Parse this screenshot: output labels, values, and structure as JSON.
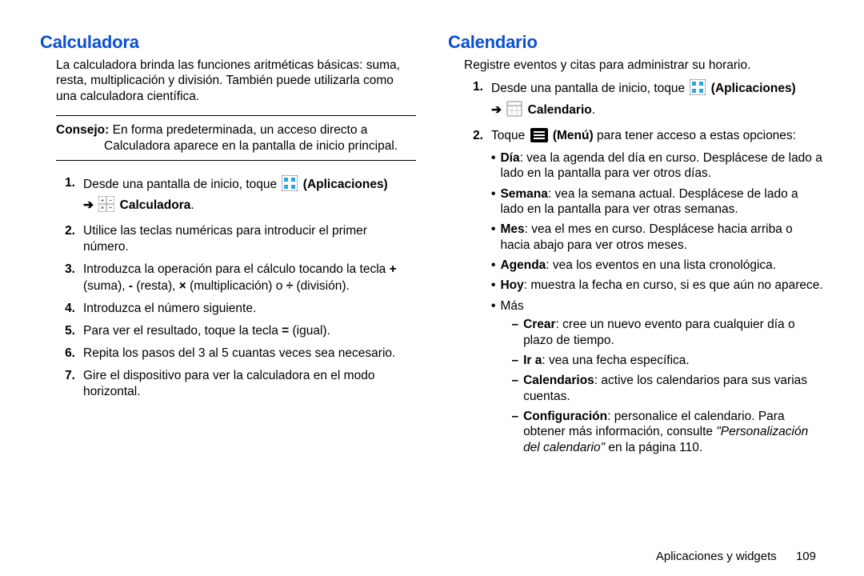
{
  "left": {
    "heading": "Calculadora",
    "intro": "La calculadora brinda las funciones aritméticas básicas: suma, resta, multiplicación y división. También puede utilizarla como una calculadora científica.",
    "tip_label": "Consejo:",
    "tip_text": "En forma predeterminada, un acceso directo a Calculadora aparece en la pantalla de inicio principal.",
    "step1_a": "Desde una pantalla de inicio, toque ",
    "apps_label": "(Aplicaciones)",
    "arrow": "➔",
    "step1_target": "Calculadora",
    "step2": "Utilice las teclas numéricas para introducir el primer número.",
    "step3_a": "Introduzca la operación para el cálculo tocando la tecla ",
    "step3_plus": "+",
    "step3_plus_txt": " (suma), ",
    "step3_minus": "-",
    "step3_minus_txt": " (resta), ",
    "step3_mult": "×",
    "step3_mult_txt": " (multiplicación) o ",
    "step3_div": "÷",
    "step3_div_txt": " (división).",
    "step4": "Introduzca el número siguiente.",
    "step5_a": "Para ver el resultado, toque la tecla ",
    "step5_eq": "=",
    "step5_eq_txt": " (igual).",
    "step6": "Repita los pasos del 3 al 5 cuantas veces sea necesario.",
    "step7": "Gire el dispositivo para ver la calculadora en el modo horizontal."
  },
  "right": {
    "heading": "Calendario",
    "intro": "Registre eventos y citas para administrar su horario.",
    "step1_a": "Desde una pantalla de inicio, toque ",
    "apps_label": "(Aplicaciones)",
    "arrow": "➔",
    "step1_target": "Calendario",
    "step2_a": "Toque ",
    "menu_label": "(Menú)",
    "step2_b": " para tener acceso a estas opciones:",
    "bul": {
      "dia_b": "Día",
      "dia_t": ": vea la agenda del día en curso. Desplácese de lado a lado en la pantalla para ver otros días.",
      "sem_b": "Semana",
      "sem_t": ": vea la semana actual. Desplácese de lado a lado en la pantalla para ver otras semanas.",
      "mes_b": "Mes",
      "mes_t": ": vea el mes en curso. Desplácese hacia arriba o hacia abajo para ver otros meses.",
      "age_b": "Agenda",
      "age_t": ": vea los eventos en una lista cronológica.",
      "hoy_b": "Hoy",
      "hoy_t": ": muestra la fecha en curso, si es que aún no aparece.",
      "mas": "Más"
    },
    "dash": {
      "crear_b": "Crear",
      "crear_t": ": cree un nuevo evento para cualquier día o plazo de tiempo.",
      "ira_b": "Ir a",
      "ira_t": ": vea una fecha específica.",
      "cal_b": "Calendarios",
      "cal_t": ": active los calendarios para sus varias cuentas.",
      "conf_b": "Configuración",
      "conf_t1": ": personalice el calendario. Para obtener más información, consulte ",
      "conf_it": "\"Personalización del calendario\"",
      "conf_t2": " en la página 110."
    }
  },
  "footer": {
    "section": "Aplicaciones y widgets",
    "page": "109"
  }
}
